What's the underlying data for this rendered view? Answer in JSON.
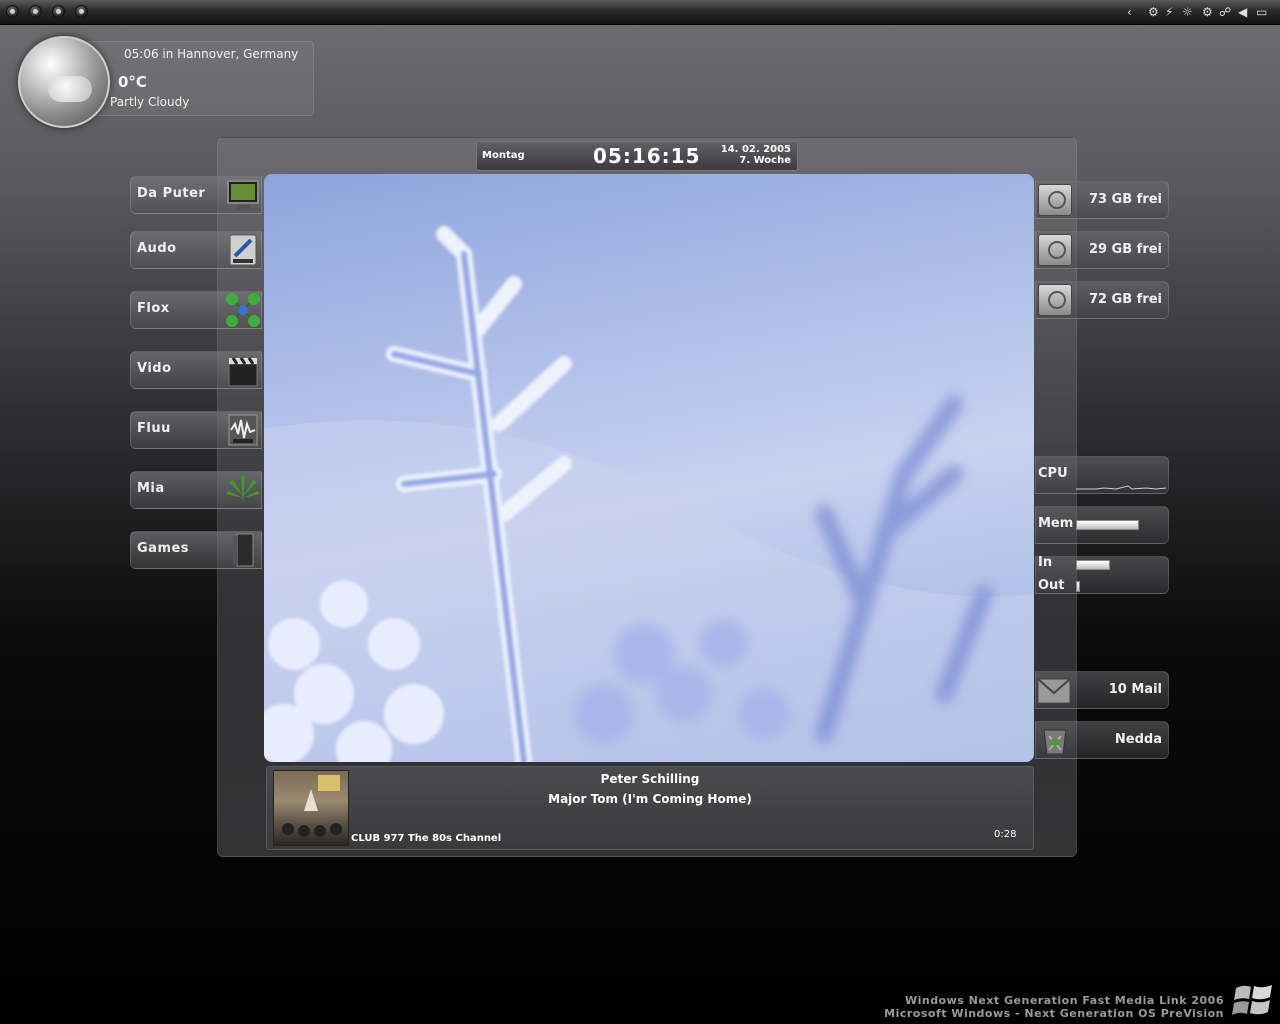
{
  "weather": {
    "location_time": "05:06 in Hannover, Germany",
    "temperature": "0°C",
    "condition": "Partly Cloudy",
    "icon": "partly-cloudy-icon"
  },
  "clock": {
    "day": "Montag",
    "time": "05:16:15",
    "date": "14. 02. 2005",
    "week": "7. Woche"
  },
  "left_menu": [
    {
      "label": "Da Puter",
      "icon": "monitor-icon"
    },
    {
      "label": "Audo",
      "icon": "mp3-icon"
    },
    {
      "label": "Flox",
      "icon": "network-icon"
    },
    {
      "label": "Vido",
      "icon": "video-clapper-icon"
    },
    {
      "label": "Fluu",
      "icon": "wav-icon"
    },
    {
      "label": "Mia",
      "icon": "leaf-icon"
    },
    {
      "label": "Games",
      "icon": "games-icon"
    }
  ],
  "drives": [
    {
      "label": "73 GB frei",
      "icon": "hard-drive-icon"
    },
    {
      "label": "29 GB frei",
      "icon": "hard-drive-icon"
    },
    {
      "label": "72 GB frei",
      "icon": "hard-drive-icon"
    }
  ],
  "system": {
    "cpu_label": "CPU",
    "mem_label": "Mem",
    "mem_level": 0.95,
    "in_label": "In",
    "in_level": 0.5,
    "out_label": "Out",
    "out_level": 0.03
  },
  "mail": {
    "label": "10 Mail",
    "icon": "mail-icon"
  },
  "trash": {
    "label": "Nedda",
    "icon": "recycle-bin-icon"
  },
  "now_playing": {
    "artist": "Peter Schilling",
    "title": "Major Tom (I'm Coming Home)",
    "station": "CLUB 977 The 80s Channel",
    "elapsed": "0:28"
  },
  "watermark": {
    "line1": "Windows Next Generation Fast Media Link 2006",
    "line2": "Microsoft Windows - Next Generation OS PreVision"
  },
  "colors": {
    "accent": "#ffffff",
    "background": "#000000",
    "wallpaper": "#a9b8e6"
  }
}
